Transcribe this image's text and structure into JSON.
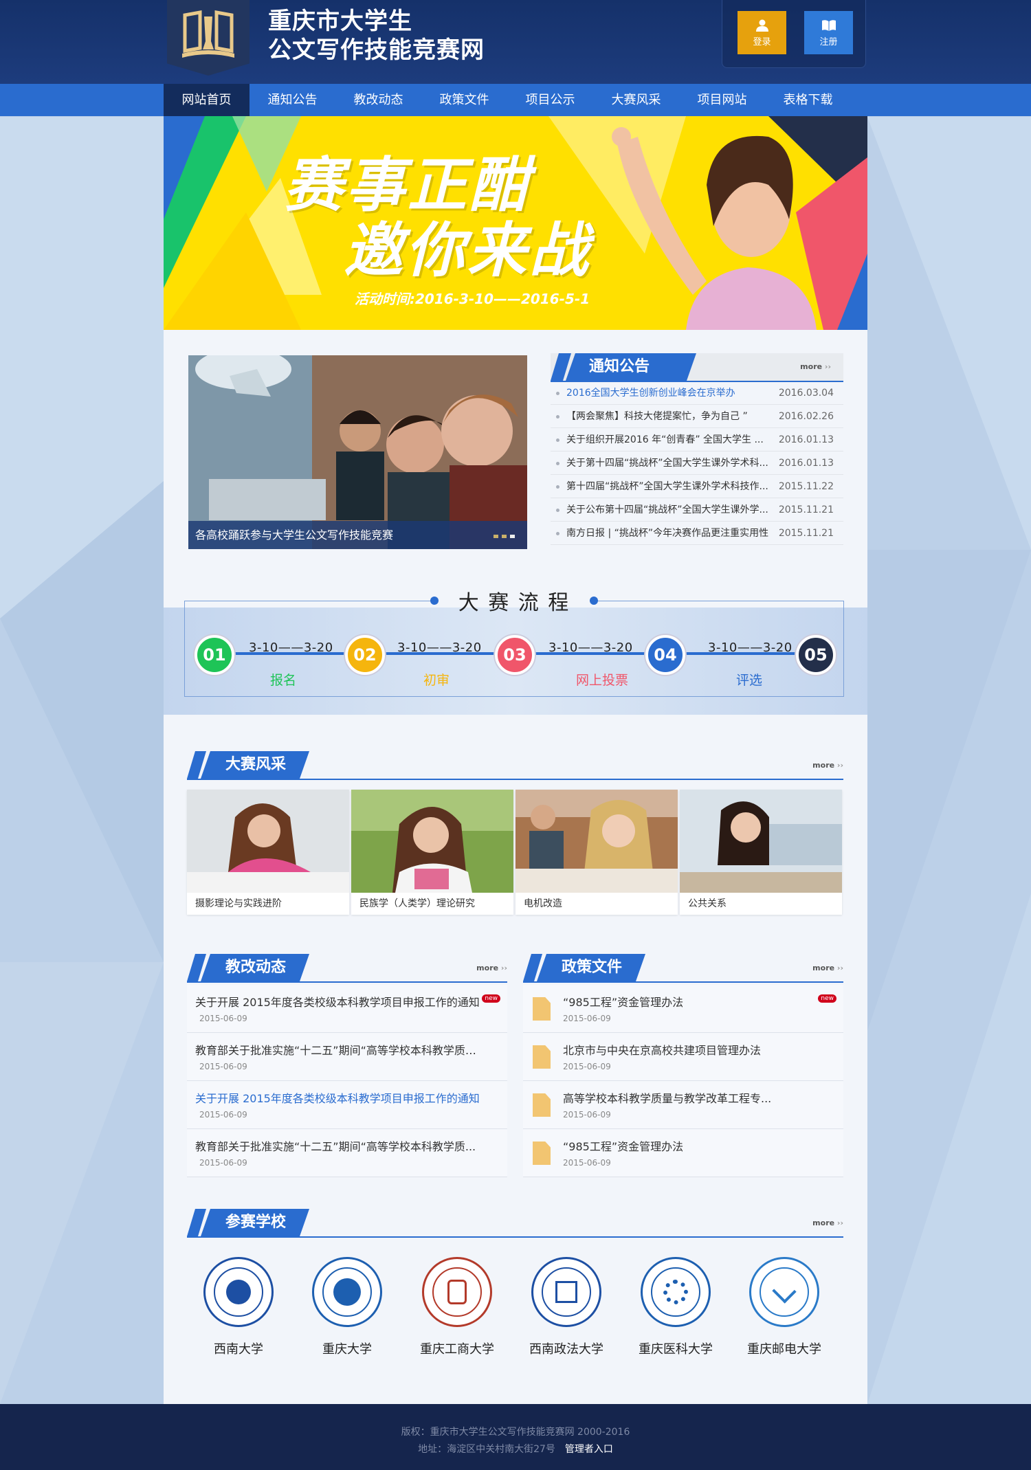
{
  "header": {
    "title_line1": "重庆市大学生",
    "title_line2": "公文写作技能竞赛网",
    "login_label": "登录",
    "register_label": "注册"
  },
  "nav": [
    {
      "label": "网站首页",
      "active": true
    },
    {
      "label": "通知公告"
    },
    {
      "label": "教改动态"
    },
    {
      "label": "政策文件"
    },
    {
      "label": "项目公示"
    },
    {
      "label": "大赛风采"
    },
    {
      "label": "项目网站"
    },
    {
      "label": "表格下载"
    }
  ],
  "banner": {
    "line1": "赛事正酣",
    "line2": "邀你来战",
    "date_text": "活动时间:2016-3-10——2016-5-1"
  },
  "slide": {
    "caption": "各高校踊跃参与大学生公文写作技能竞赛"
  },
  "notice": {
    "title": "通知公告",
    "more": "more",
    "items": [
      {
        "title": "2016全国大学生创新创业峰会在京举办",
        "date": "2016.03.04",
        "highlight": true
      },
      {
        "title": "【两会聚焦】科技大佬提案忙，争为自己 ”",
        "date": "2016.02.26"
      },
      {
        "title": "关于组织开展2016 年“创青春” 全国大学生 ...",
        "date": "2016.01.13"
      },
      {
        "title": "关于第十四届“挑战杯”全国大学生课外学术科...",
        "date": "2016.01.13"
      },
      {
        "title": " 第十四届“挑战杯”全国大学生课外学术科技作...",
        "date": "2015.11.22"
      },
      {
        "title": "关于公布第十四届“挑战杯”全国大学生课外学...",
        "date": "2015.11.21"
      },
      {
        "title": "南方日报 | “挑战杯”今年决赛作品更注重实用性",
        "date": "2015.11.21"
      }
    ]
  },
  "process": {
    "title": "大 赛 流 程",
    "steps": [
      {
        "num": "01",
        "name": "报名",
        "color": "#1ec457"
      },
      {
        "num": "02",
        "name": "初审",
        "color": "#f5b50d"
      },
      {
        "num": "03",
        "name": "网上投票",
        "color": "#f0566a"
      },
      {
        "num": "04",
        "name": "评选",
        "color": "#2a6ccf"
      },
      {
        "num": "05",
        "name": "",
        "color": "#232f4a"
      }
    ],
    "dates": [
      "3-10——3-20",
      "3-10——3-20",
      "3-10——3-20",
      "3-10——3-20"
    ]
  },
  "gallery": {
    "title": "大赛风采",
    "more": "more",
    "items": [
      {
        "caption": "摄影理论与实践进阶"
      },
      {
        "caption": "民族学（人类学）理论研究"
      },
      {
        "caption": "电机改造"
      },
      {
        "caption": "公共关系"
      }
    ]
  },
  "reform": {
    "title": "教改动态",
    "more": "more",
    "items": [
      {
        "title": "关于开展 2015年度各类校级本科教学项目申报工作的通知",
        "date": "2015-06-09",
        "new": "new"
      },
      {
        "title": "教育部关于批准实施“十二五”期间“高等学校本科教学质量...",
        "date": "2015-06-09"
      },
      {
        "title": "关于开展 2015年度各类校级本科教学项目申报工作的通知",
        "date": "2015-06-09",
        "highlight": true
      },
      {
        "title": "教育部关于批准实施“十二五”期间“高等学校本科教学质...",
        "date": "2015-06-09"
      }
    ]
  },
  "policy": {
    "title": "政策文件",
    "more": "more",
    "items": [
      {
        "title": "“985工程”资金管理办法",
        "date": "2015-06-09",
        "new": "new"
      },
      {
        "title": "北京市与中央在京高校共建项目管理办法",
        "date": "2015-06-09"
      },
      {
        "title": "高等学校本科教学质量与教学改革工程专...",
        "date": "2015-06-09"
      },
      {
        "title": "“985工程”资金管理办法",
        "date": "2015-06-09"
      }
    ]
  },
  "schools": {
    "title": "参赛学校",
    "more": "more",
    "items": [
      {
        "name": "西南大学",
        "color": "#1d4fa3"
      },
      {
        "name": "重庆大学",
        "color": "#1d5fb0"
      },
      {
        "name": "重庆工商大学",
        "color": "#b33a2a"
      },
      {
        "name": "西南政法大学",
        "color": "#1d4fa3"
      },
      {
        "name": "重庆医科大学",
        "color": "#1d5fb0"
      },
      {
        "name": "重庆邮电大学",
        "color": "#2a7ac8"
      }
    ]
  },
  "footer": {
    "copyright": "版权：重庆市大学生公文写作技能竞赛网  2000-2016",
    "address": "地址：海淀区中关村南大街27号",
    "admin": "管理者入口"
  }
}
